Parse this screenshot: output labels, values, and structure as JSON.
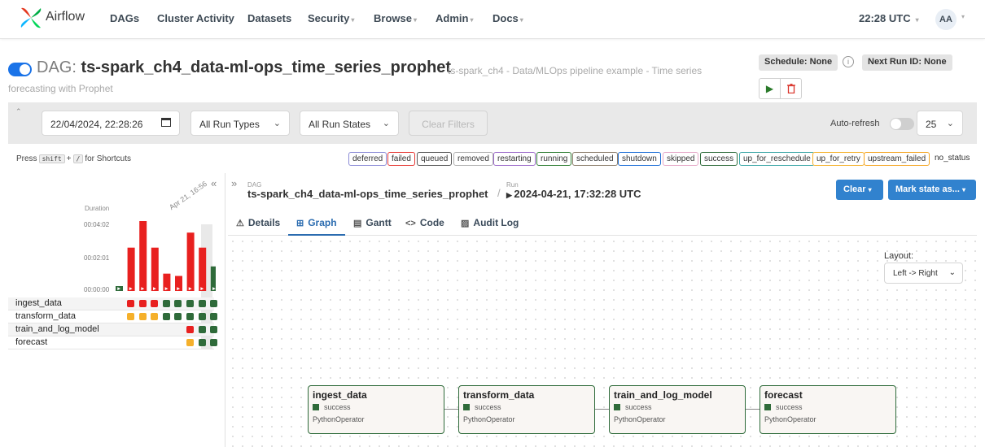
{
  "nav": {
    "brand": "Airflow",
    "items": [
      {
        "label": "DAGs",
        "dropdown": false
      },
      {
        "label": "Cluster Activity",
        "dropdown": false
      },
      {
        "label": "Datasets",
        "dropdown": false
      },
      {
        "label": "Security",
        "dropdown": true
      },
      {
        "label": "Browse",
        "dropdown": true
      },
      {
        "label": "Admin",
        "dropdown": true
      },
      {
        "label": "Docs",
        "dropdown": true
      }
    ],
    "clock": "22:28 UTC",
    "user_initials": "AA"
  },
  "dag": {
    "prefix": "DAG:",
    "name": "ts-spark_ch4_data-ml-ops_time_series_prophet",
    "description_line1": "ts-spark_ch4 - Data/MLOps pipeline example - Time series",
    "description_line2": "forecasting with Prophet",
    "schedule": "Schedule: None",
    "next_run": "Next Run ID: None",
    "paused": false
  },
  "filters": {
    "date": "22/04/2024, 22:28:26",
    "run_types": "All Run Types",
    "run_states": "All Run States",
    "clear": "Clear Filters",
    "auto_refresh_label": "Auto-refresh",
    "auto_refresh_on": false,
    "page_size": "25"
  },
  "shortcuts": {
    "press": "Press",
    "key1": "shift",
    "plus": "+",
    "key2": "/",
    "suffix": "for Shortcuts"
  },
  "states": [
    {
      "label": "deferred",
      "color": "#8b8bd6"
    },
    {
      "label": "failed",
      "color": "#e53935"
    },
    {
      "label": "queued",
      "color": "#555555"
    },
    {
      "label": "removed",
      "color": "#b0b0b0"
    },
    {
      "label": "restarting",
      "color": "#9b6ac9"
    },
    {
      "label": "running",
      "color": "#2e7d32"
    },
    {
      "label": "scheduled",
      "color": "#8b7d6b"
    },
    {
      "label": "shutdown",
      "color": "#1e6fd6"
    },
    {
      "label": "skipped",
      "color": "#e6a8c8"
    },
    {
      "label": "success",
      "color": "#2e6b3a"
    },
    {
      "label": "up_for_reschedule",
      "color": "#3aa6a6"
    },
    {
      "label": "up_for_retry",
      "color": "#f5b12b"
    },
    {
      "label": "upstream_failed",
      "color": "#f5a623"
    },
    {
      "label": "no_status",
      "color": null
    }
  ],
  "grid": {
    "duration_label": "Duration",
    "yticks": [
      "00:04:02",
      "00:02:01",
      "00:00:00"
    ],
    "date_label": "Apr 21, 16:56",
    "run_durations_sec": [
      14,
      150,
      242,
      150,
      60,
      52,
      202,
      150,
      85
    ],
    "run_states": [
      "success",
      "failed",
      "failed",
      "failed",
      "failed",
      "failed",
      "failed",
      "failed",
      "success"
    ],
    "tasks": [
      {
        "name": "ingest_data",
        "cells": [
          "failed",
          "failed",
          "failed",
          "success",
          "success",
          "success",
          "success",
          "success"
        ]
      },
      {
        "name": "transform_data",
        "cells": [
          "upstream_failed",
          "upstream_failed",
          "upstream_failed",
          "success",
          "success",
          "success",
          "success",
          "success"
        ]
      },
      {
        "name": "train_and_log_model",
        "cells": [
          "",
          "",
          "",
          "",
          "",
          "failed",
          "success",
          "success"
        ]
      },
      {
        "name": "forecast",
        "cells": [
          "",
          "",
          "",
          "",
          "",
          "upstream_failed",
          "success",
          "success"
        ]
      }
    ]
  },
  "breadcrumb": {
    "dag_label": "DAG",
    "dag_value": "ts-spark_ch4_data-ml-ops_time_series_prophet",
    "sep": "/",
    "run_label": "Run",
    "run_value": "2024-04-21, 17:32:28 UTC"
  },
  "actions": {
    "clear": "Clear",
    "mark_state": "Mark state as..."
  },
  "tabs": [
    "Details",
    "Graph",
    "Gantt",
    "Code",
    "Audit Log"
  ],
  "active_tab": "Graph",
  "layout": {
    "label": "Layout:",
    "value": "Left -> Right"
  },
  "graph_nodes": [
    {
      "title": "ingest_data",
      "status": "success",
      "operator": "PythonOperator"
    },
    {
      "title": "transform_data",
      "status": "success",
      "operator": "PythonOperator"
    },
    {
      "title": "train_and_log_model",
      "status": "success",
      "operator": "PythonOperator"
    },
    {
      "title": "forecast",
      "status": "success",
      "operator": "PythonOperator"
    }
  ],
  "colors": {
    "success": "#2f6b3a",
    "failed": "#e8201f",
    "upstream_failed": "#f5b02b",
    "accent": "#3182ce"
  }
}
